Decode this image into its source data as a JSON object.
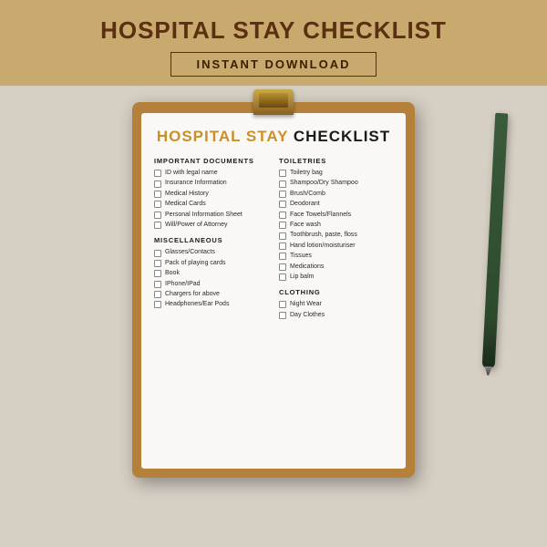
{
  "banner": {
    "title": "HOSPITAL STAY CHECKLIST",
    "instant_download": "INSTANT DOWNLOAD"
  },
  "paper": {
    "title_highlight": "HOSPITAL STAY",
    "title_rest": "CHECKLIST",
    "sections": {
      "left": [
        {
          "heading": "IMPORTANT DOCUMENTS",
          "items": [
            "ID with legal name",
            "Insurance Information",
            "Medical History",
            "Medical Cards",
            "Personal Information Sheet",
            "Will/Power of Attorney"
          ]
        },
        {
          "heading": "MISCELLANEOUS",
          "items": [
            "Glasses/Contacts",
            "Pack of playing cards",
            "Book",
            "IPhone/IPad",
            "Chargers for above",
            "Headphones/Ear Pods"
          ]
        }
      ],
      "right": [
        {
          "heading": "TOILETRIES",
          "items": [
            "Toiletry bag",
            "Shampoo/Dry Shampoo",
            "Brush/Comb",
            "Deodorant",
            "Face Towels/Flannels",
            "Face wash",
            "Toothbrush, paste, floss",
            "Hand lotion/moisturiser",
            "Tissues",
            "Medications",
            "Lip balm"
          ]
        },
        {
          "heading": "CLOTHING",
          "items": [
            "Night Wear",
            "Day Clothes"
          ]
        }
      ]
    }
  }
}
